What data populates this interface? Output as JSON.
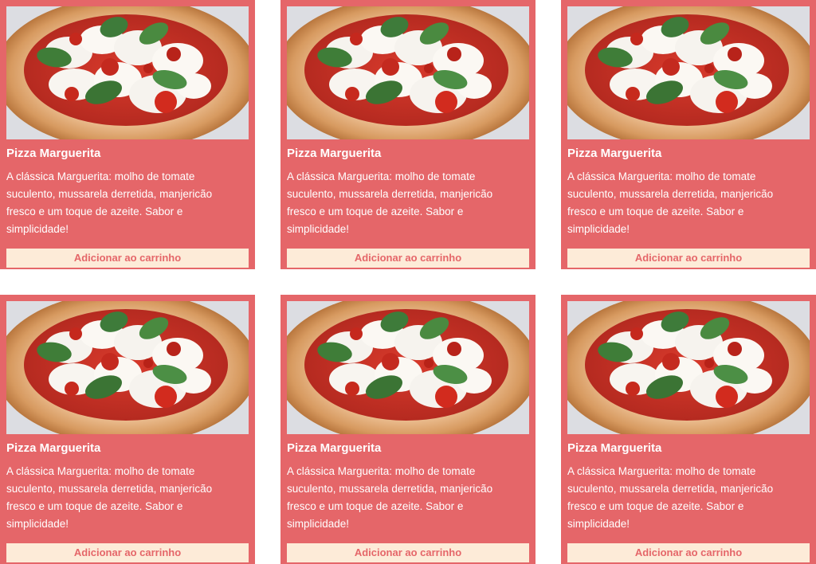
{
  "products": [
    {
      "title": "Pizza Marguerita",
      "description": "A clássica Marguerita: molho de tomate suculento, mussarela derretida, manjericão fresco e um toque de azeite. Sabor e simplicidade!",
      "button_label": "Adicionar ao carrinho"
    },
    {
      "title": "Pizza Marguerita",
      "description": "A clássica Marguerita: molho de tomate suculento, mussarela derretida, manjericão fresco e um toque de azeite. Sabor e simplicidade!",
      "button_label": "Adicionar ao carrinho"
    },
    {
      "title": "Pizza Marguerita",
      "description": "A clássica Marguerita: molho de tomate suculento, mussarela derretida, manjericão fresco e um toque de azeite. Sabor e simplicidade!",
      "button_label": "Adicionar ao carrinho"
    },
    {
      "title": "Pizza Marguerita",
      "description": "A clássica Marguerita: molho de tomate suculento, mussarela derretida, manjericão fresco e um toque de azeite. Sabor e simplicidade!",
      "button_label": "Adicionar ao carrinho"
    },
    {
      "title": "Pizza Marguerita",
      "description": "A clássica Marguerita: molho de tomate suculento, mussarela derretida, manjericão fresco e um toque de azeite. Sabor e simplicidade!",
      "button_label": "Adicionar ao carrinho"
    },
    {
      "title": "Pizza Marguerita",
      "description": "A clássica Marguerita: molho de tomate suculento, mussarela derretida, manjericão fresco e um toque de azeite. Sabor e simplicidade!",
      "button_label": "Adicionar ao carrinho"
    }
  ],
  "colors": {
    "card_background": "#e56669",
    "button_background": "#fdebd8",
    "button_text": "#e56669",
    "text": "#ffffff"
  }
}
